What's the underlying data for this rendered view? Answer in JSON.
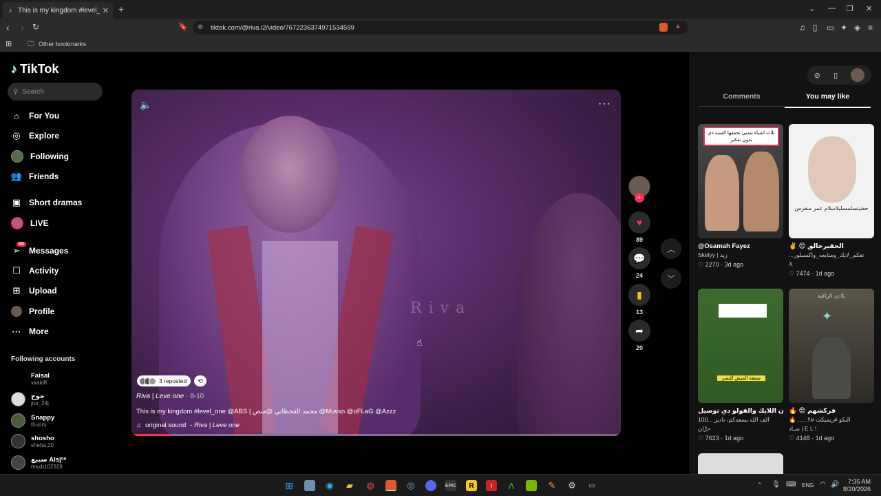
{
  "browser": {
    "tab_title": "This is my kingdom #level_one",
    "url": "tiktok.com/@riva.i2/video/7672236374971534599",
    "bookmarks_label": "Other bookmarks"
  },
  "sidebar": {
    "brand": "TikTok",
    "search_placeholder": "Search",
    "nav": [
      {
        "label": "For You",
        "icon": "home-icon"
      },
      {
        "label": "Explore",
        "icon": "compass-icon"
      },
      {
        "label": "Following",
        "icon": "following-avatar-icon"
      },
      {
        "label": "Friends",
        "icon": "friends-icon"
      },
      {
        "label": "Short dramas",
        "icon": "film-icon"
      },
      {
        "label": "LIVE",
        "icon": "live-icon"
      },
      {
        "label": "Messages",
        "icon": "paper-plane-icon",
        "badge": "10"
      },
      {
        "label": "Activity",
        "icon": "activity-icon"
      },
      {
        "label": "Upload",
        "icon": "plus-square-icon"
      },
      {
        "label": "Profile",
        "icon": "profile-avatar-icon"
      },
      {
        "label": "More",
        "icon": "more-icon"
      }
    ],
    "following_title": "Following accounts",
    "accounts": [
      {
        "name": "Faisal",
        "user": "xxaio8"
      },
      {
        "name": "جوج",
        "user": "jno_24j"
      },
      {
        "name": "Snappy",
        "user": "thuoru"
      },
      {
        "name": "shosho",
        "user": "sheha.20"
      },
      {
        "name": "سبيع Als|ᵒᵃ",
        "user": "msxb102928"
      }
    ]
  },
  "video": {
    "watermark": "Riva",
    "reposted_label": "3 reposted",
    "author": "Riva | Leve one",
    "date": "· 8-10",
    "caption": "This is my kingdom #level_one @ABS | محمد القحطاني @منص @Muvxn @oFLaG @Azzz",
    "sound_label": "original sound",
    "sound_author": "- Riva | Leve one",
    "progress": 0.08
  },
  "actions": {
    "likes": "89",
    "comments": "24",
    "saves": "13",
    "shares": "20"
  },
  "right_panel": {
    "tabs": [
      "Comments",
      "You may like"
    ],
    "active_tab": "You may like",
    "cards": [
      {
        "title": "@Osamah Fayez",
        "sub": "Skelyy | زيد",
        "likes": "2270",
        "age": "3d ago",
        "overlay": "ثلاث اشياء تتمنى تحققها السنة دي بدون تفكير"
      },
      {
        "title": "✌️ 😍 الحقيرخالق",
        "sub": "...تعكم_لايك_ومتابعه_واكسبلور",
        "sub2": "X",
        "likes": "7474",
        "age": "1d ago",
        "overlay": "حقنيتسلمسليلاسلام عمر منقرس"
      },
      {
        "title": "لا تنسون اللايك والفولو دي توصيل",
        "sub": "100... الف الله يسعدكم، ناديز",
        "sub2": "حرَّان",
        "likes": "7623",
        "age": "1d ago",
        "overlay": "صفقة الميش للنصر"
      },
      {
        "title": "🔥 😍 فركشهم",
        "sub": "🔥 ......!!# النكو #ريميكت",
        "sub2": "سـاد | E L !",
        "likes": "4148",
        "age": "1d ago",
        "overlay": "بلادي الراقية"
      }
    ]
  },
  "taskbar": {
    "time": "7:35 AM",
    "date": "8/20/2026",
    "lang": "ENG"
  }
}
